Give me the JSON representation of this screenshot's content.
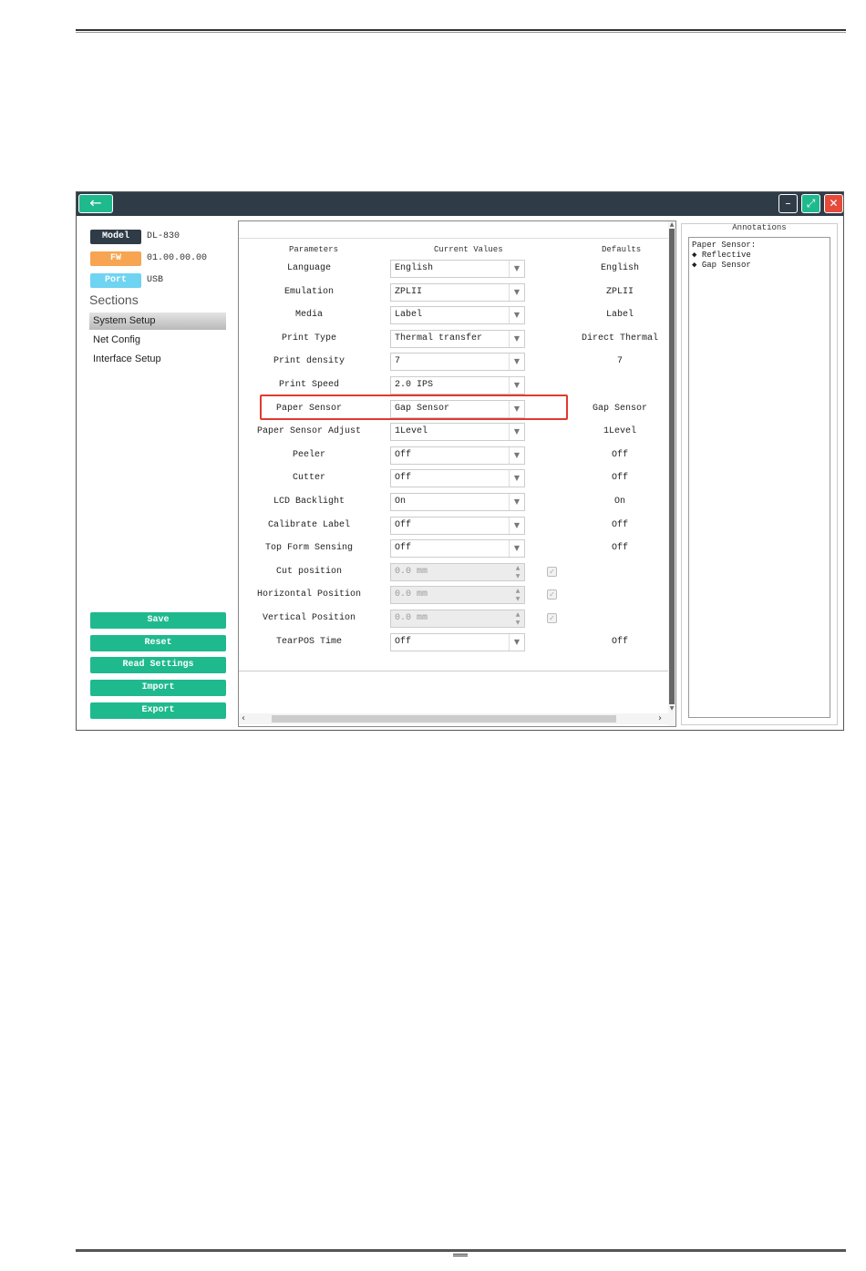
{
  "window": {
    "back_icon": "arrow-left-icon",
    "minimize_icon": "minimize-icon",
    "maximize_icon": "maximize-icon",
    "close_icon": "close-icon"
  },
  "info": {
    "model_label": "Model",
    "model_value": "DL-830",
    "fw_label": "FW",
    "fw_value": "01.00.00.00",
    "port_label": "Port",
    "port_value": "USB"
  },
  "sections": {
    "label": "Sections",
    "items": [
      "System Setup",
      "Net Config",
      "Interface Setup"
    ]
  },
  "actions": [
    "Save",
    "Reset",
    "Read Settings",
    "Import",
    "Export"
  ],
  "table": {
    "headers": {
      "parameters": "Parameters",
      "current": "Current Values",
      "defaults": "Defaults"
    },
    "rows": [
      {
        "label": "Language",
        "value": "English",
        "default": "English"
      },
      {
        "label": "Emulation",
        "value": "ZPLII",
        "default": "ZPLII"
      },
      {
        "label": "Media",
        "value": "Label",
        "default": "Label"
      },
      {
        "label": "Print Type",
        "value": "Thermal transfer",
        "default": "Direct Thermal"
      },
      {
        "label": "Print density",
        "value": "7",
        "default": "7"
      },
      {
        "label": "Print Speed",
        "value": "2.0 IPS",
        "default": ""
      },
      {
        "label": "Paper Sensor",
        "value": "Gap Sensor",
        "default": "Gap Sensor"
      },
      {
        "label": "Paper Sensor Adjust",
        "value": "1Level",
        "default": "1Level"
      },
      {
        "label": "Peeler",
        "value": "Off",
        "default": "Off"
      },
      {
        "label": "Cutter",
        "value": "Off",
        "default": "Off"
      },
      {
        "label": "LCD Backlight",
        "value": "On",
        "default": "On"
      },
      {
        "label": "Calibrate Label",
        "value": "Off",
        "default": "Off"
      },
      {
        "label": "Top Form Sensing",
        "value": "Off",
        "default": "Off"
      },
      {
        "label": "Cut position",
        "value": "0.0 mm",
        "default": ""
      },
      {
        "label": "Horizontal Position",
        "value": "0.0 mm",
        "default": ""
      },
      {
        "label": "Vertical Position",
        "value": "0.0 mm",
        "default": ""
      },
      {
        "label": "TearPOS Time",
        "value": "Off",
        "default": "Off"
      }
    ]
  },
  "annotations": {
    "title": "Annotations",
    "heading": "Paper Sensor:",
    "items": [
      "Reflective",
      "Gap Sensor"
    ],
    "bullet": "◆"
  }
}
